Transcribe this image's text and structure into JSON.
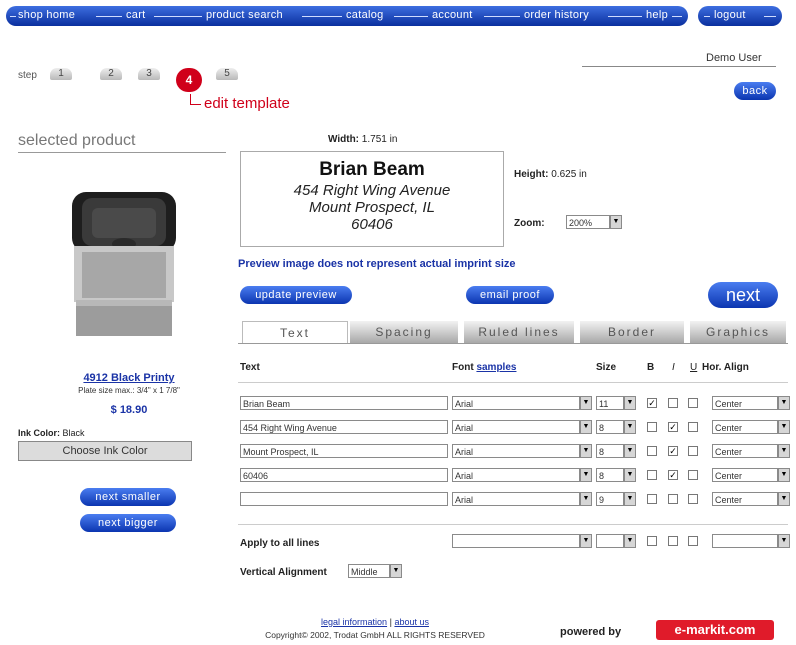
{
  "nav": {
    "items": [
      "shop home",
      "cart",
      "product search",
      "catalog",
      "account",
      "order history",
      "help"
    ],
    "logout": "logout"
  },
  "user": "Demo User",
  "steps": {
    "label": "step",
    "numbers": [
      "1",
      "2",
      "3",
      "4",
      "5"
    ],
    "current_label": "edit template"
  },
  "buttons": {
    "back": "back",
    "next": "next",
    "update_preview": "update preview",
    "email_proof": "email proof",
    "next_smaller": "next smaller",
    "next_bigger": "next bigger",
    "choose_ink": "Choose Ink Color"
  },
  "product": {
    "section_title": "selected product",
    "name": "4912 Black Printy",
    "plate_size": "Plate size max.: 3/4\" x 1 7/8\"",
    "price": "$ 18.90",
    "ink_color_label": "Ink Color:",
    "ink_color_value": "Black"
  },
  "preview": {
    "width_label": "Width:",
    "width_value": "1.751",
    "height_label": "Height:",
    "height_value": "0.625",
    "unit": "in",
    "zoom_label": "Zoom:",
    "zoom_value": "200%",
    "lines": [
      "Brian Beam",
      "454 Right Wing Avenue",
      "Mount Prospect, IL",
      "60406"
    ],
    "notice": "Preview image does not represent actual imprint size"
  },
  "tabs": [
    "Text",
    "Spacing",
    "Ruled lines",
    "Border",
    "Graphics"
  ],
  "table": {
    "headers": {
      "text": "Text",
      "font": "Font",
      "samples": "samples",
      "size": "Size",
      "b": "B",
      "i": "I",
      "u": "U",
      "align": "Hor. Align"
    },
    "rows": [
      {
        "text": "Brian Beam",
        "font": "Arial",
        "size": "11",
        "b": true,
        "i": false,
        "u": false,
        "align": "Center"
      },
      {
        "text": "454 Right Wing Avenue",
        "font": "Arial",
        "size": "8",
        "b": false,
        "i": true,
        "u": false,
        "align": "Center"
      },
      {
        "text": "Mount Prospect, IL",
        "font": "Arial",
        "size": "8",
        "b": false,
        "i": true,
        "u": false,
        "align": "Center"
      },
      {
        "text": "60406",
        "font": "Arial",
        "size": "8",
        "b": false,
        "i": true,
        "u": false,
        "align": "Center"
      },
      {
        "text": "",
        "font": "Arial",
        "size": "9",
        "b": false,
        "i": false,
        "u": false,
        "align": "Center"
      }
    ],
    "apply_all_label": "Apply to all lines",
    "vertical_align_label": "Vertical Alignment",
    "vertical_align_value": "Middle"
  },
  "footer": {
    "legal": "legal information",
    "divider": "|",
    "about": "about us",
    "copyright": "Copyright© 2002, Trodat GmbH ALL RIGHTS RESERVED",
    "powered_by": "powered by",
    "brand": "e-markit.com"
  },
  "colors": {
    "nav_blue": "#0a2f9e",
    "accent_red": "#d0001a",
    "link_blue": "#1a33a6"
  }
}
